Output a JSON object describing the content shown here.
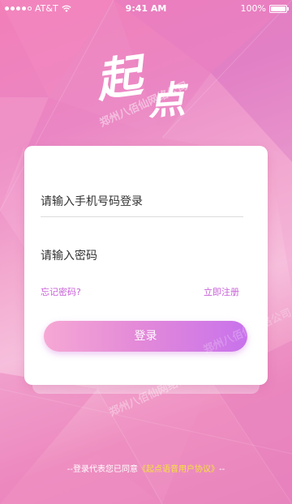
{
  "status_bar": {
    "carrier": "AT&T",
    "time": "9:41 AM",
    "battery_percent": "100%"
  },
  "logo": {
    "char1": "起",
    "char2": "点"
  },
  "watermark": {
    "text": "郑州八佰仙网络公司"
  },
  "login_form": {
    "phone_placeholder": "请输入手机号码登录",
    "password_placeholder": "请输入密码",
    "forgot_password": "忘记密码?",
    "register": "立即注册",
    "login_button": "登录"
  },
  "agreement": {
    "prefix": "--登录代表您已同意",
    "link": "《起点语音用户协议》",
    "suffix": "--"
  },
  "colors": {
    "background_pink": "#f27fb8",
    "link_purple": "#c85fd8",
    "agreement_yellow": "#f7e23a",
    "button_gradient_start": "#f6a8d4",
    "button_gradient_end": "#c872ec"
  }
}
